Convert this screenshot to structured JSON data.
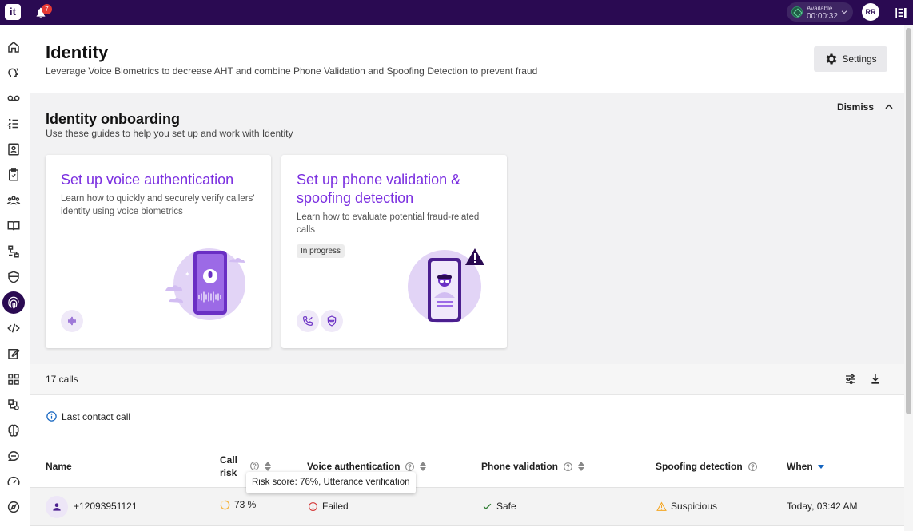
{
  "topbar": {
    "logo_text": "it",
    "notifications_count": "7",
    "status_label": "Available",
    "status_timer": "00:00:32",
    "user_initials": "RR"
  },
  "page": {
    "title": "Identity",
    "subtitle": "Leverage Voice Biometrics to decrease AHT and combine Phone Validation and Spoofing Detection to prevent fraud",
    "settings_label": "Settings"
  },
  "onboarding": {
    "title": "Identity onboarding",
    "subtitle": "Use these guides to help you set up and work with Identity",
    "dismiss_label": "Dismiss",
    "cards": [
      {
        "title": "Set up voice authentication",
        "description": "Learn how to quickly and securely verify callers' identity using voice biometrics"
      },
      {
        "title": "Set up phone validation & spoofing detection",
        "description": "Learn how to evaluate potential fraud-related calls",
        "status": "In progress"
      }
    ]
  },
  "calls": {
    "count_label": "17 calls",
    "last_contact_label": "Last contact call",
    "columns": {
      "name": "Name",
      "call_risk_line1": "Call",
      "call_risk_line2": "risk",
      "voice_auth": "Voice authentication",
      "phone_validation": "Phone validation",
      "spoofing": "Spoofing detection",
      "when": "When"
    },
    "tooltip": "Risk score: 76%, Utterance verification",
    "rows": [
      {
        "name": "+12093951121",
        "risk": "73 %",
        "risk_value": 0.73,
        "voice_auth": "Failed",
        "phone_validation": "Safe",
        "spoofing": "Suspicious",
        "when": "Today, 03:42 AM"
      }
    ]
  },
  "colors": {
    "brand_dark": "#2a0a52",
    "accent_purple": "#7b2fe0",
    "failed": "#d32f2f",
    "safe": "#2e7d32",
    "warning": "#f5a623",
    "risk_ring": "#f5b642"
  }
}
